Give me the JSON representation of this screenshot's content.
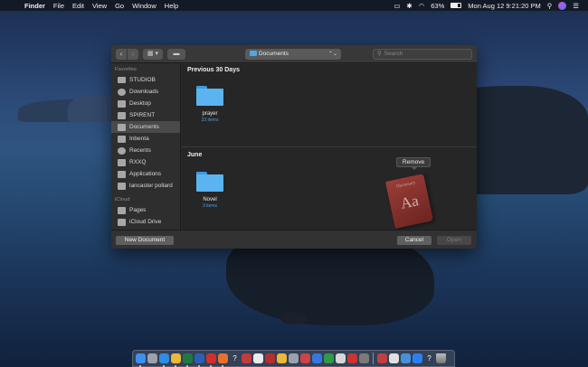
{
  "menubar": {
    "app_name": "Finder",
    "menus": [
      "File",
      "Edit",
      "View",
      "Go",
      "Window",
      "Help"
    ],
    "battery_percent": "63%",
    "battery_level": 0.63,
    "datetime": "Mon Aug 12  9:21:20 PM"
  },
  "toolbar": {
    "back_icon": "‹",
    "forward_icon": "›",
    "location_label": "Documents",
    "location_updown": "⌃⌄",
    "search_placeholder": "Search"
  },
  "sidebar": {
    "favorites_header": "Favorites",
    "favorites": [
      {
        "label": "STUDIOB",
        "icon": "disk-icon"
      },
      {
        "label": "Downloads",
        "icon": "downloads-icon"
      },
      {
        "label": "Desktop",
        "icon": "desktop-icon"
      },
      {
        "label": "SPIRENT",
        "icon": "folder-icon"
      },
      {
        "label": "Documents",
        "icon": "documents-icon"
      },
      {
        "label": "Inbenta",
        "icon": "folder-icon"
      },
      {
        "label": "Recents",
        "icon": "recents-icon"
      },
      {
        "label": "RXXQ",
        "icon": "folder-icon"
      },
      {
        "label": "Applications",
        "icon": "applications-icon"
      },
      {
        "label": "lancaster pollard",
        "icon": "folder-icon"
      }
    ],
    "icloud_header": "iCloud",
    "icloud": [
      {
        "label": "Pages",
        "icon": "pages-icon"
      },
      {
        "label": "iCloud Drive",
        "icon": "cloud-icon"
      }
    ],
    "active_item": "Documents"
  },
  "content": {
    "section1_title": "Previous 30 Days",
    "section1_folder": {
      "name": "prayer",
      "count": "33 items"
    },
    "section2_title": "June",
    "section2_folder": {
      "name": "Novel",
      "count": "3 items"
    },
    "tooltip": "Remove",
    "drag_icon": {
      "name": "Dictionary",
      "glyph": "Aa"
    }
  },
  "buttons": {
    "new_document": "New Document",
    "cancel": "Cancel",
    "open": "Open"
  },
  "dock_apps": [
    "finder",
    "launchpad",
    "safari",
    "chrome",
    "excel",
    "word",
    "opera",
    "firefox",
    "help",
    "photo-booth",
    "app",
    "app",
    "chrome",
    "app",
    "app",
    "keynote",
    "numbers",
    "app",
    "app",
    "app",
    "app",
    "app",
    "app",
    "appstore",
    "help",
    "trash"
  ],
  "colors": {
    "accent": "#4f9fe0",
    "folder": "#5bb4ef",
    "dialog_bg": "#2b2b2b"
  }
}
